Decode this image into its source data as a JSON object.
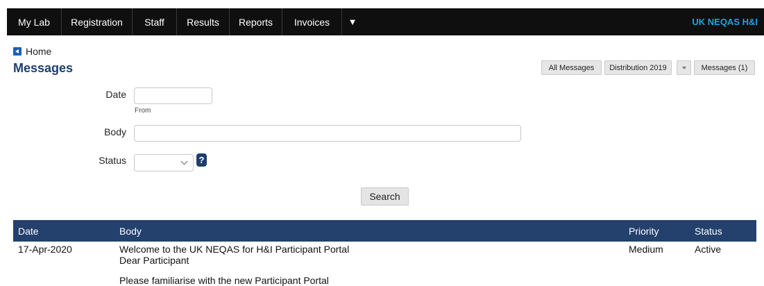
{
  "nav": {
    "items": [
      "My Lab",
      "Registration",
      "Staff",
      "Results",
      "Reports",
      "Invoices"
    ],
    "more_glyph": "▼",
    "brand": "UK NEQAS H&I"
  },
  "breadcrumb": {
    "home": "Home"
  },
  "page": {
    "title": "Messages"
  },
  "actions": {
    "all_messages": "All Messages",
    "distribution": "Distribution 2019",
    "messages": "Messages (1)"
  },
  "form": {
    "date_label": "Date",
    "date_value": "",
    "date_hint": "From",
    "body_label": "Body",
    "body_value": "",
    "status_label": "Status",
    "status_value": "",
    "help_glyph": "?",
    "search_label": "Search"
  },
  "table": {
    "columns": [
      "Date",
      "Body",
      "Priority",
      "Status"
    ],
    "rows": [
      {
        "date": "17-Apr-2020",
        "body_line1": "Welcome to the UK NEQAS for H&I Participant Portal",
        "body_line2": "Dear Participant",
        "body_line3": "Please familiarise with the new Participant Portal",
        "priority": "Medium",
        "status": "Active"
      }
    ]
  },
  "colors": {
    "header_bar": "#0f0f0f",
    "brand": "#1ea3e6",
    "title": "#1e3f6e",
    "table_header": "#24406d"
  }
}
